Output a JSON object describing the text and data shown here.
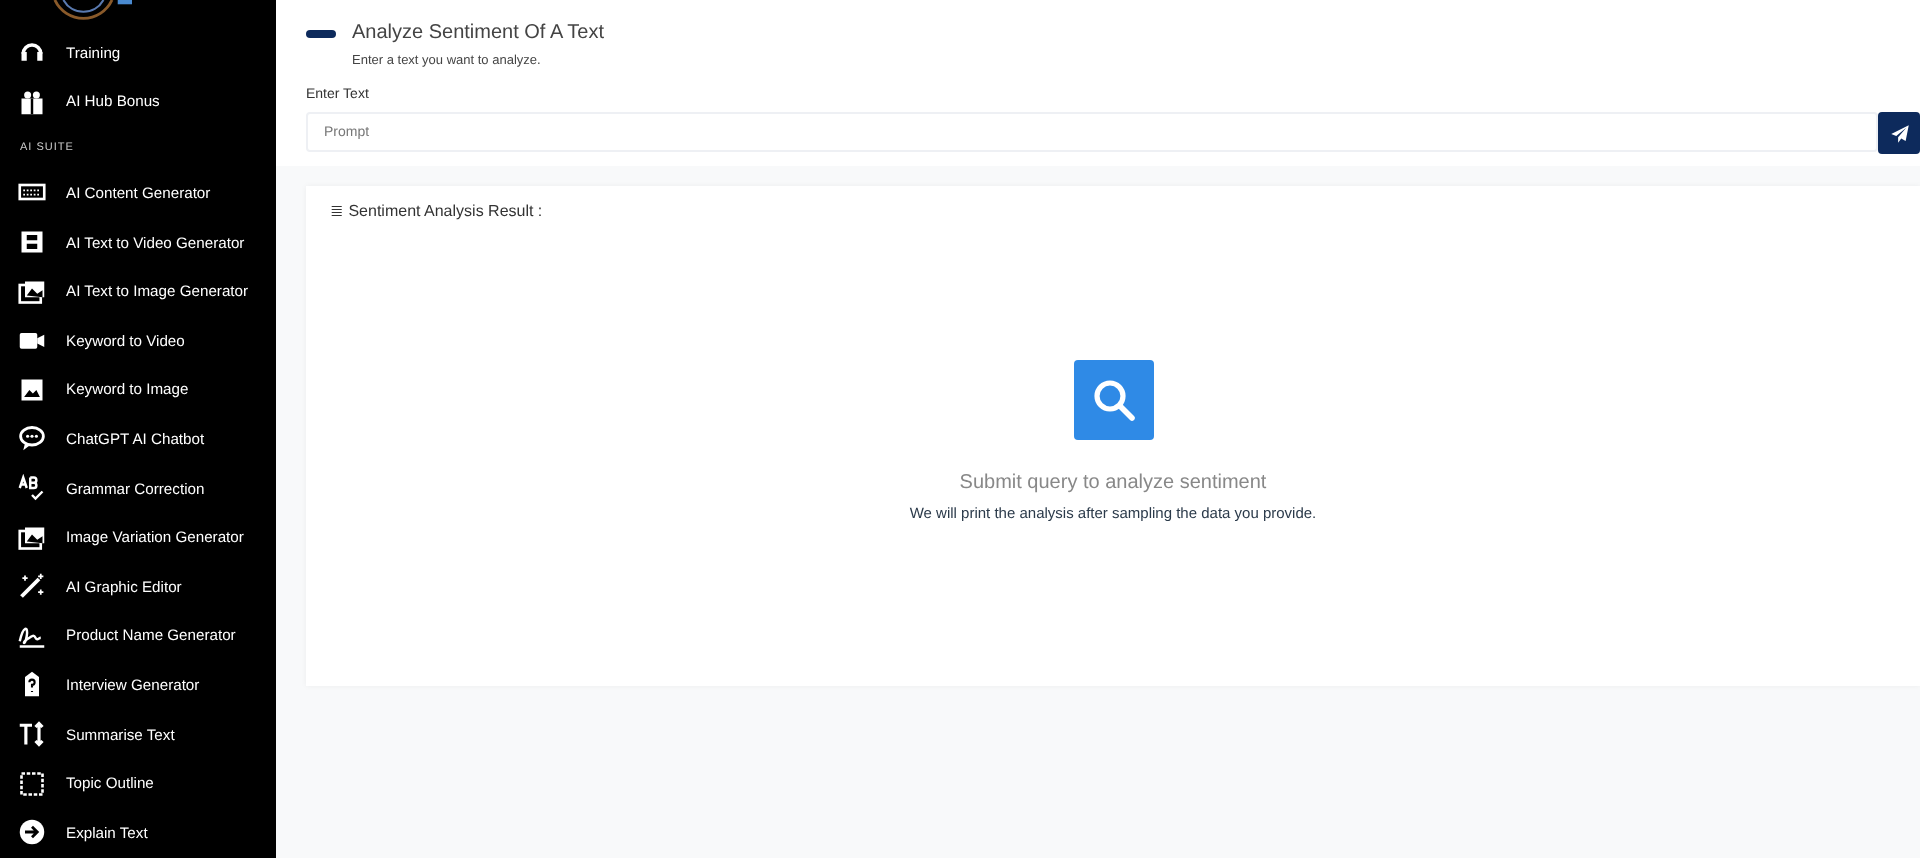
{
  "sidebar": {
    "items": [
      {
        "label": "Training",
        "kind": "headset"
      },
      {
        "label": "AI Hub Bonus",
        "kind": "gift"
      },
      {
        "kind": "section",
        "label": "AI SUITE"
      },
      {
        "label": "AI Content Generator",
        "kind": "keyboard"
      },
      {
        "label": "AI Text to Video Generator",
        "kind": "film"
      },
      {
        "label": "AI Text to Image Generator",
        "kind": "images"
      },
      {
        "label": "Keyword to Video",
        "kind": "camera"
      },
      {
        "label": "Keyword to Image",
        "kind": "image"
      },
      {
        "label": "ChatGPT AI Chatbot",
        "kind": "chat"
      },
      {
        "label": "Grammar Correction",
        "kind": "ab"
      },
      {
        "label": "Image Variation Generator",
        "kind": "images"
      },
      {
        "label": "AI Graphic Editor",
        "kind": "wand"
      },
      {
        "label": "Product Name Generator",
        "kind": "sign"
      },
      {
        "label": "Interview Generator",
        "kind": "question"
      },
      {
        "label": "Summarise Text",
        "kind": "textsize"
      },
      {
        "label": "Topic Outline",
        "kind": "square"
      },
      {
        "label": "Explain Text",
        "kind": "arrow"
      }
    ]
  },
  "header": {
    "title": "Analyze Sentiment Of A Text",
    "subtitle": "Enter a text you want to analyze."
  },
  "form": {
    "label": "Enter Text",
    "placeholder": "Prompt"
  },
  "result": {
    "title": "≣ Sentiment Analysis Result :",
    "empty_title": "Submit query to analyze sentiment",
    "empty_text": "We will print the analysis after sampling the data you provide."
  }
}
